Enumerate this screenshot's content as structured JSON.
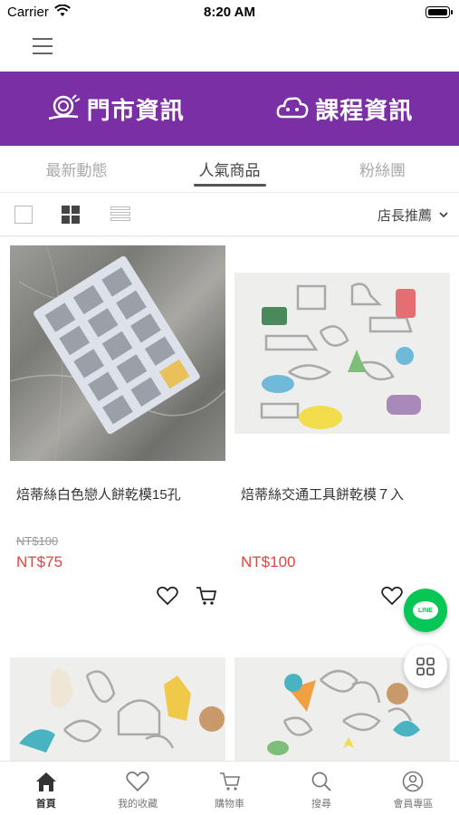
{
  "status": {
    "carrier": "Carrier",
    "time": "8:20 AM"
  },
  "banner": {
    "store_info": "門市資訊",
    "course_info": "課程資訊"
  },
  "tabs": [
    {
      "label": "最新動態",
      "active": false
    },
    {
      "label": "人氣商品",
      "active": true
    },
    {
      "label": "粉絲團",
      "active": false
    }
  ],
  "sort": {
    "label": "店長推薦"
  },
  "products": [
    {
      "name": "焙蒂絲白色戀人餅乾模15孔",
      "old_price": "NT$100",
      "price": "NT$75"
    },
    {
      "name": "焙蒂絲交通工具餅乾模７入",
      "old_price": "",
      "price": "NT$100"
    }
  ],
  "floating": {
    "line_label": "LINE"
  },
  "bottom_nav": [
    {
      "label": "首頁",
      "icon": "home-icon",
      "active": true
    },
    {
      "label": "我的收藏",
      "icon": "heart-icon",
      "active": false
    },
    {
      "label": "購物車",
      "icon": "cart-icon",
      "active": false
    },
    {
      "label": "搜尋",
      "icon": "search-icon",
      "active": false
    },
    {
      "label": "會員專區",
      "icon": "user-icon",
      "active": false
    }
  ],
  "colors": {
    "brand_purple": "#7b2fa5",
    "price_red": "#e8413c",
    "line_green": "#06c755"
  }
}
